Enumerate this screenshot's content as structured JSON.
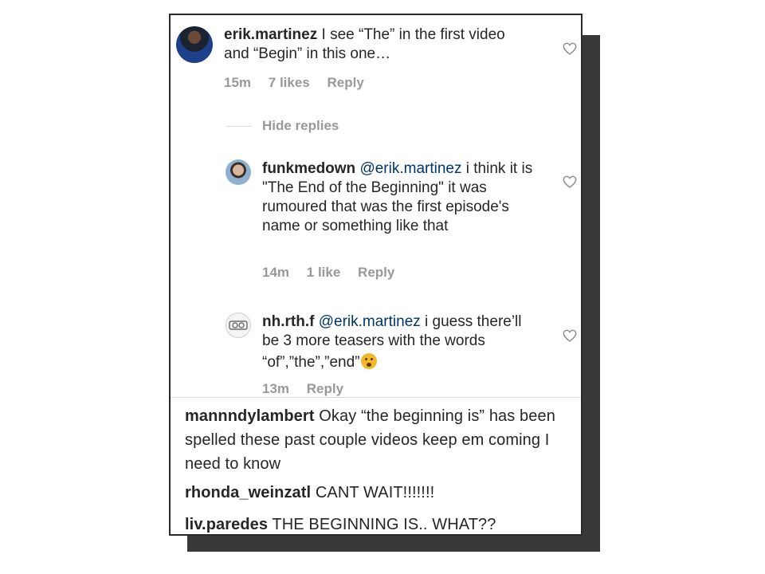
{
  "comments": [
    {
      "username": "erik.martinez",
      "text": "I see “The” in the first video and “Begin” in this one…",
      "time": "15m",
      "likes": "7 likes",
      "reply": "Reply"
    }
  ],
  "hide_replies": "Hide replies",
  "replies": [
    {
      "username": "funkmedown",
      "mention": "@erik.martinez",
      "text": "i think it is \"The End of the Beginning\" it was rumoured that was the first episode's name or something like that",
      "time": "14m",
      "likes": "1 like",
      "reply": "Reply"
    },
    {
      "username": "nh.rth.f",
      "mention": "@erik.martinez",
      "text": "i guess there’ll be 3 more teasers with the words “of”,”the”,”end”",
      "time": "13m",
      "reply": "Reply"
    }
  ],
  "more_comments": [
    {
      "username": "mannndylambert",
      "text": "Okay “the beginning is” has been spelled these past couple videos keep em coming I need to know"
    },
    {
      "username": "rhonda_weinzatl",
      "text": "CANT WAIT!!!!!!!"
    },
    {
      "username": "liv.paredes",
      "text": "THE BEGINNING IS.. WHAT??"
    }
  ],
  "icons": {
    "like": "heart-outline-icon",
    "emoji": "shushing-face-emoji"
  },
  "colors": {
    "mention": "#003569",
    "meta": "#999999",
    "text": "#262626",
    "shadow": "#383936"
  }
}
